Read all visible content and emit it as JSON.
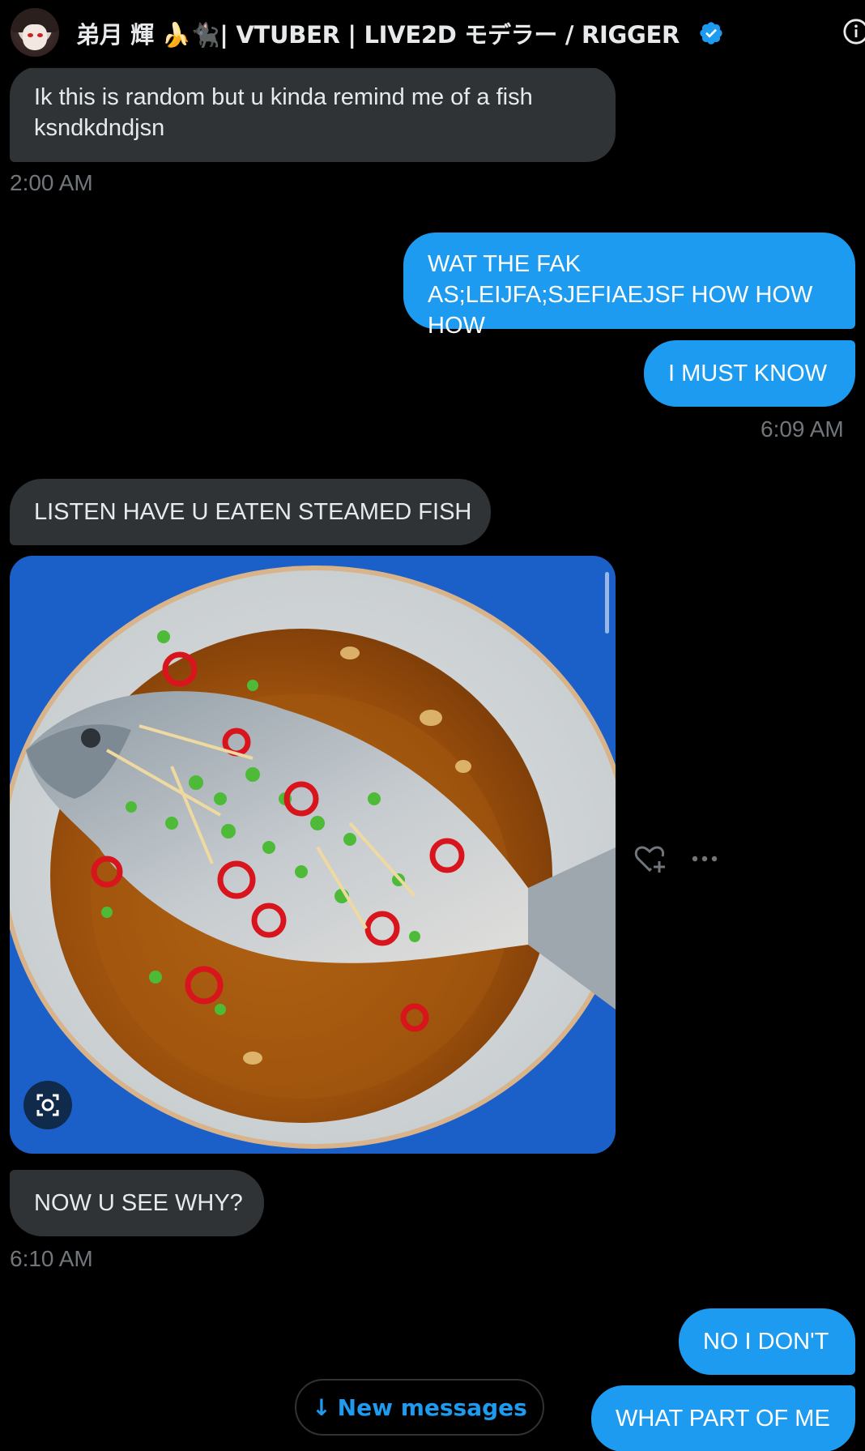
{
  "header": {
    "title": "弟月 輝 🍌🐈‍⬛| VTUBER | LIVE2D モデラー / RIGGER",
    "verified": true,
    "accent": "#1d9bf0"
  },
  "messages": [
    {
      "side": "received",
      "text": "Ik this is random but u kinda remind me of a fish ksndkdndjsn"
    },
    {
      "side": "timestamp",
      "text": "2:00 AM"
    },
    {
      "side": "sent",
      "text": "WAT THE FAK AS;LEIJFA;SJEFIAEJSF HOW HOW HOW"
    },
    {
      "side": "sent",
      "text": "I MUST KNOW"
    },
    {
      "side": "timestamp",
      "text": "6:09 AM"
    },
    {
      "side": "received",
      "text": "LISTEN HAVE U EATEN STEAMED FISH"
    },
    {
      "side": "received-image",
      "alt_icon": "lens-icon"
    },
    {
      "side": "received",
      "text": "NOW U SEE WHY?"
    },
    {
      "side": "timestamp",
      "text": "6:10 AM"
    },
    {
      "side": "sent",
      "text": "NO I DON'T"
    },
    {
      "side": "sent",
      "text": "WHAT PART OF ME"
    }
  ],
  "actions": {
    "react_icon": "heart-plus-icon",
    "more_icon": "more-horizontal-icon"
  },
  "new_messages": {
    "label": "New messages",
    "icon": "arrow-down-icon"
  },
  "colors": {
    "background": "#000000",
    "received_bubble": "#2f3336",
    "sent_bubble": "#1d9bf0",
    "timestamp": "#71767b"
  }
}
